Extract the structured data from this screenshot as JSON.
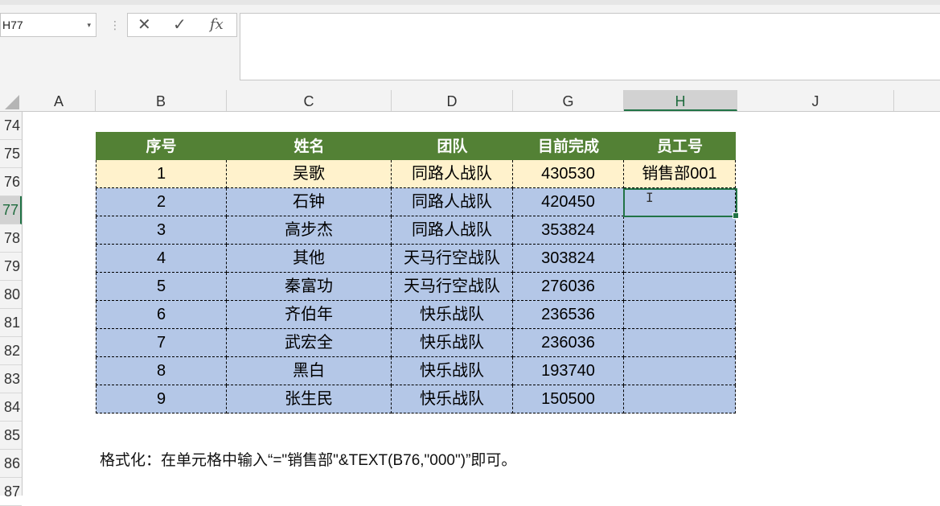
{
  "formula_bar": {
    "name_box": "H77",
    "name_box_dropdown": "▾",
    "separator": "⋮",
    "cancel_symbol": "✕",
    "enter_symbol": "✓",
    "fx_symbol": "fx",
    "formula_value": ""
  },
  "columns": [
    {
      "label": "A"
    },
    {
      "label": "B"
    },
    {
      "label": "C"
    },
    {
      "label": "D"
    },
    {
      "label": "G"
    },
    {
      "label": "H",
      "selected": true
    },
    {
      "label": "J"
    }
  ],
  "rows": [
    "74",
    "75",
    "76",
    "77",
    "78",
    "79",
    "80",
    "81",
    "82",
    "83",
    "84",
    "85",
    "86",
    "87"
  ],
  "selected_row": "77",
  "table": {
    "headers": [
      "序号",
      "姓名",
      "团队",
      "目前完成",
      "员工号"
    ],
    "rows": [
      [
        "1",
        "吴歌",
        "同路人战队",
        "430530",
        "销售部001"
      ],
      [
        "2",
        "石钟",
        "同路人战队",
        "420450",
        ""
      ],
      [
        "3",
        "高步杰",
        "同路人战队",
        "353824",
        ""
      ],
      [
        "4",
        "其他",
        "天马行空战队",
        "303824",
        ""
      ],
      [
        "5",
        "秦富功",
        "天马行空战队",
        "276036",
        ""
      ],
      [
        "6",
        "齐伯年",
        "快乐战队",
        "236536",
        ""
      ],
      [
        "7",
        "武宏全",
        "快乐战队",
        "236036",
        ""
      ],
      [
        "8",
        "黑白",
        "快乐战队",
        "193740",
        ""
      ],
      [
        "9",
        "张生民",
        "快乐战队",
        "150500",
        ""
      ]
    ]
  },
  "note": "格式化：在单元格中输入“=\"销售部\"&TEXT(B76,\"000\")”即可。",
  "cursor_symbol": "I",
  "colors": {
    "header_green": "#538135",
    "first_row_fill": "#fff2cc",
    "row_fill": "#b4c7e7",
    "selection_green": "#217346"
  }
}
